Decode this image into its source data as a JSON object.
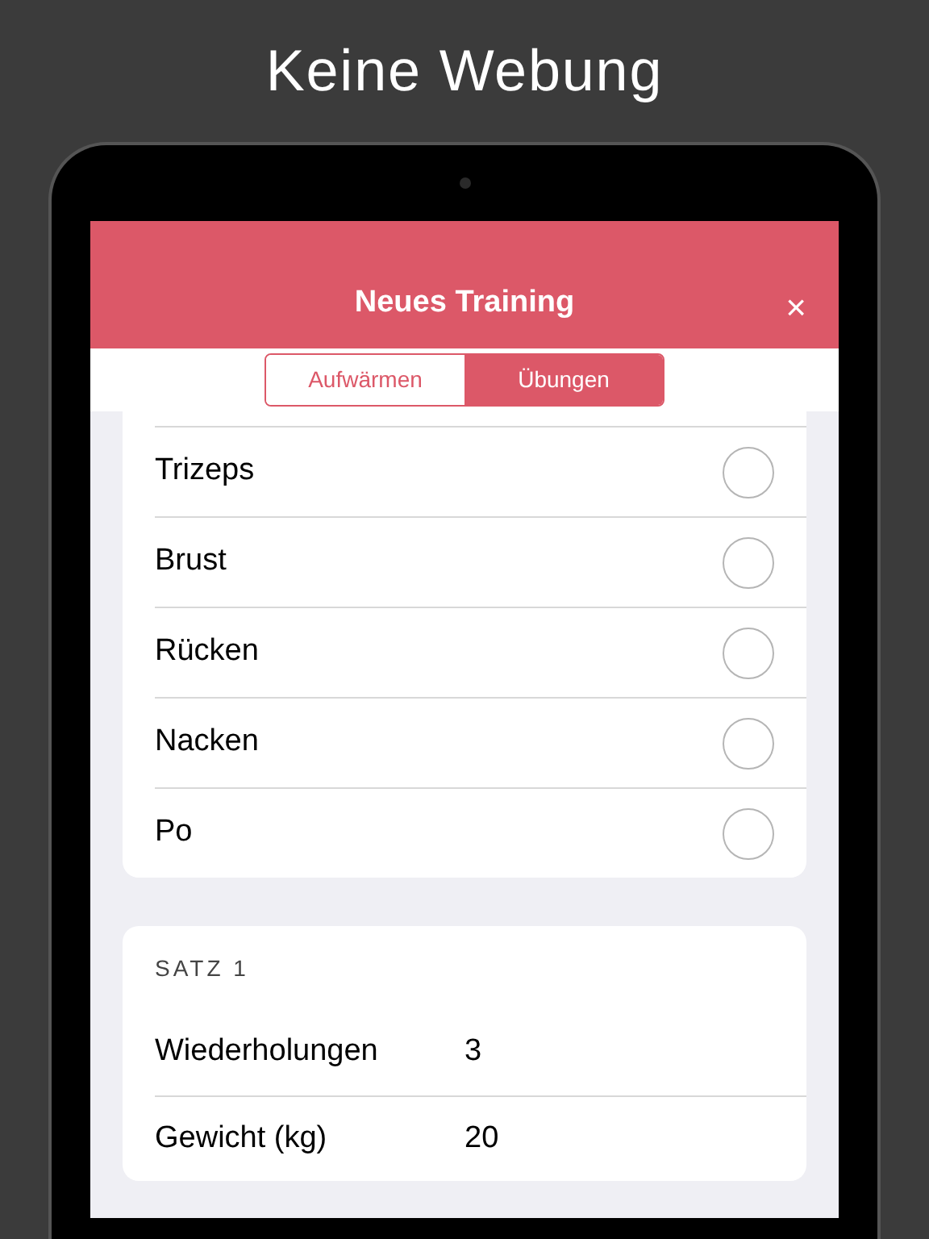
{
  "headline": "Keine Webung",
  "screen": {
    "title": "Neues Training",
    "close": "×",
    "segments": [
      {
        "label": "Aufwärmen",
        "selected": false
      },
      {
        "label": "Übungen",
        "selected": true
      }
    ],
    "exercises": [
      {
        "name": "Trizeps",
        "checked": false
      },
      {
        "name": "Brust",
        "checked": false
      },
      {
        "name": "Rücken",
        "checked": false
      },
      {
        "name": "Nacken",
        "checked": false
      },
      {
        "name": "Po",
        "checked": false
      }
    ],
    "set": {
      "header": "SATZ 1",
      "rows": [
        {
          "label": "Wiederholungen",
          "value": "3"
        },
        {
          "label": "Gewicht (kg)",
          "value": "20"
        }
      ]
    }
  }
}
